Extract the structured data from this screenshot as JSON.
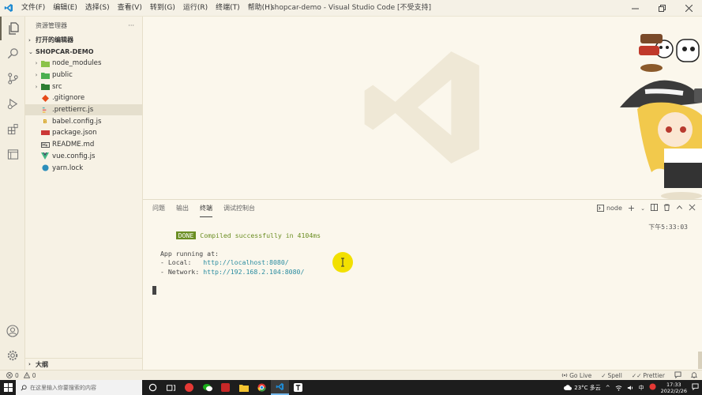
{
  "window": {
    "title": "shopcar-demo - Visual Studio Code [不受支持]",
    "menu": [
      "文件(F)",
      "编辑(E)",
      "选择(S)",
      "查看(V)",
      "转到(G)",
      "运行(R)",
      "终端(T)",
      "帮助(H)"
    ]
  },
  "sidebar": {
    "title": "资源管理器",
    "more": "···",
    "open_editors": "打开的编辑器",
    "project": "SHOPCAR-DEMO",
    "items": [
      {
        "label": "node_modules",
        "type": "folder",
        "icon": "folder-node-icon"
      },
      {
        "label": "public",
        "type": "folder",
        "icon": "folder-public-icon"
      },
      {
        "label": "src",
        "type": "folder",
        "icon": "folder-src-icon"
      },
      {
        "label": ".gitignore",
        "type": "file",
        "icon": "git-icon"
      },
      {
        "label": ".prettierrc.js",
        "type": "file",
        "icon": "prettier-icon"
      },
      {
        "label": "babel.config.js",
        "type": "file",
        "icon": "babel-icon"
      },
      {
        "label": "package.json",
        "type": "file",
        "icon": "npm-icon"
      },
      {
        "label": "README.md",
        "type": "file",
        "icon": "markdown-icon"
      },
      {
        "label": "vue.config.js",
        "type": "file",
        "icon": "vue-icon"
      },
      {
        "label": "yarn.lock",
        "type": "file",
        "icon": "yarn-icon"
      }
    ],
    "outline": "大纲"
  },
  "panel": {
    "tabs": [
      "问题",
      "输出",
      "终端",
      "调试控制台"
    ],
    "active_tab": "终端",
    "terminal_name": "node",
    "terminal": {
      "done_badge": "DONE",
      "compiled": "Compiled successfully in 4104ms",
      "time": "下午5:33:03",
      "running": "App running at:",
      "local_label": "- Local:   ",
      "local_url": "http://localhost:8080/",
      "network_label": "- Network: ",
      "network_url": "http://192.168.2.104:8080/"
    }
  },
  "statusbar": {
    "errors": "0",
    "warnings": "0",
    "golive": "Go Live",
    "spell": "Spell",
    "prettier": "Prettier"
  },
  "taskbar": {
    "search_placeholder": "在这里输入你要搜索的内容",
    "weather": "23°C 多云",
    "time": "17:33",
    "date": "2022/2/26"
  },
  "colors": {
    "accent": "#6b8e23",
    "link": "#2a8ca0",
    "vscode_blue": "#1f8ad2"
  }
}
